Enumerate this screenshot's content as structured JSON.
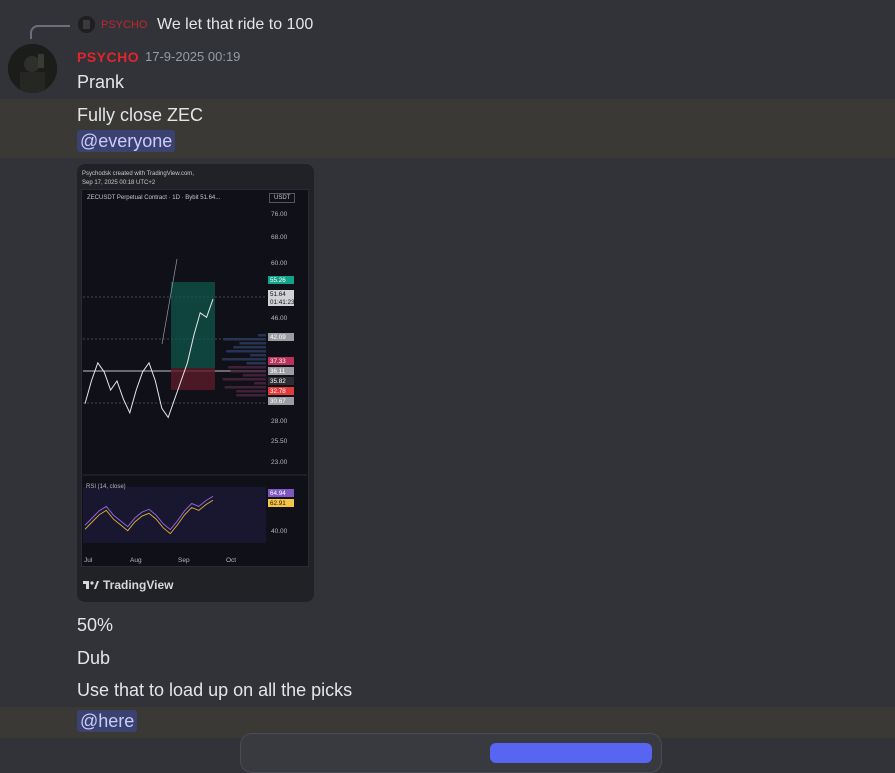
{
  "reply": {
    "author": "PSYCHO",
    "text": "We let that ride to 100"
  },
  "message": {
    "author": "PSYCHO",
    "timestamp": "17-9-2025 00:19",
    "lines": [
      "Prank",
      "Fully close ZEC"
    ],
    "mention_everyone": "@everyone",
    "after_lines": [
      "50%",
      "Dub",
      "Use that to load up on all the picks"
    ],
    "mention_here": "@here"
  },
  "embed": {
    "header_line1": "Psychodsk created with TradingView.com,",
    "header_line2": "Sep 17, 2025 00:18 UTC+2",
    "chart_title": "ZECUSDT Perpetual Contract · 1D · Bybit  51.64...",
    "currency": "USDT",
    "footer": "TradingView"
  },
  "chart_data": {
    "type": "line",
    "title": "ZECUSDT Perpetual Contract · 1D · Bybit  51.64...",
    "x_ticks": [
      "Jul",
      "Aug",
      "Sep",
      "Oct"
    ],
    "y_ticks": [
      "76.00",
      "68.00",
      "60.00",
      "46.00",
      "28.00",
      "25.50",
      "23.00"
    ],
    "price_labels": [
      {
        "text": "55.26",
        "color": "#13a38a"
      },
      {
        "text": "51.64",
        "color": "#d0d2d6"
      },
      {
        "text": "01:41:23",
        "color": "#d0d2d6"
      },
      {
        "text": "42.09",
        "color": "#9b9da3"
      },
      {
        "text": "37.33",
        "color": "#b8325b"
      },
      {
        "text": "36.11",
        "color": "#9b9da3"
      },
      {
        "text": "35.82",
        "color": "#2b2d33"
      },
      {
        "text": "32.78",
        "color": "#e23a3a"
      },
      {
        "text": "30.67",
        "color": "#9b9da3"
      }
    ],
    "rsi_label": "RSI (14, close)",
    "rsi_tick": "40.00",
    "rsi_values": [
      {
        "text": "64.94",
        "color": "#7e57c2"
      },
      {
        "text": "62.91",
        "color": "#f5c542"
      }
    ],
    "price_series": [
      35,
      40,
      44,
      42,
      38,
      40,
      36,
      33,
      38,
      42,
      44,
      40,
      34,
      32,
      36,
      40,
      44,
      50,
      55,
      54,
      58
    ],
    "rsi_series": [
      45,
      50,
      55,
      58,
      52,
      48,
      44,
      50,
      54,
      56,
      52,
      46,
      42,
      48,
      55,
      60,
      58,
      62,
      65
    ]
  },
  "colors": {
    "background": "#323339",
    "username": "#e0262b",
    "mention_bg": "#3c4270",
    "mention_text": "#c9cdfb"
  }
}
